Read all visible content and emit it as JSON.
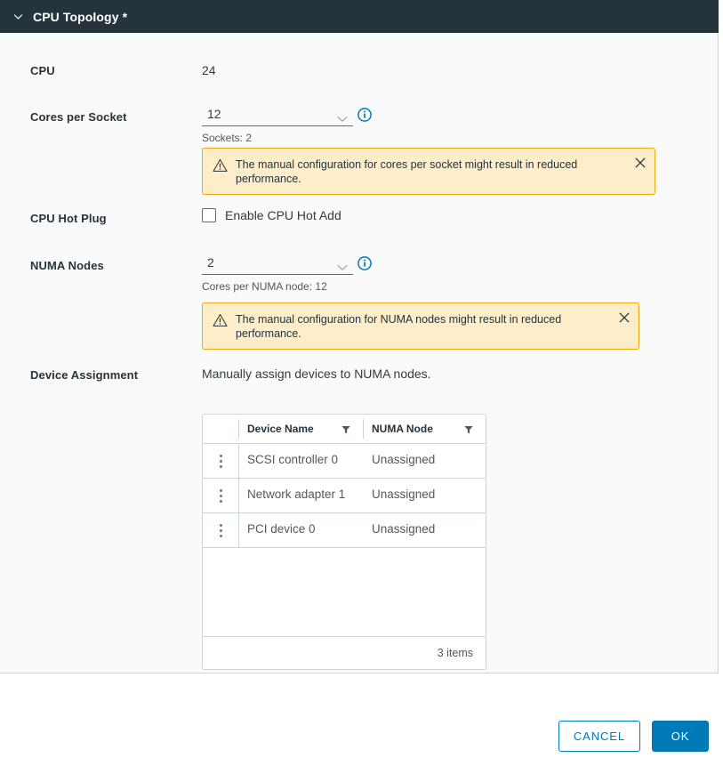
{
  "header": {
    "title": "CPU Topology *",
    "collapse_icon": "chevron-down-icon"
  },
  "fields": {
    "cpu": {
      "label": "CPU",
      "value": "24"
    },
    "cores_per_socket": {
      "label": "Cores per Socket",
      "value": "12",
      "info_icon": "info-circle-icon",
      "note": "Sockets: 2"
    },
    "cpu_hot_plug": {
      "label": "CPU Hot Plug",
      "checkbox_label": "Enable CPU Hot Add",
      "checked": false
    },
    "numa_nodes": {
      "label": "NUMA Nodes",
      "value": "2",
      "info_icon": "info-circle-icon",
      "note": "Cores per NUMA node: 12"
    },
    "device_assignment": {
      "label": "Device Assignment",
      "description": "Manually assign devices to NUMA nodes."
    }
  },
  "alerts": [
    {
      "icon": "warning-triangle-icon",
      "text": "The manual configuration for cores per socket might result in reduced performance.",
      "close_icon": "close-icon"
    },
    {
      "icon": "warning-triangle-icon",
      "text": "The manual configuration for NUMA nodes might result in reduced performance.",
      "close_icon": "close-icon"
    }
  ],
  "grid": {
    "columns": [
      {
        "label": "",
        "filter": false
      },
      {
        "label": "Device Name",
        "filter": true,
        "filter_icon": "filter-icon"
      },
      {
        "label": "NUMA Node",
        "filter": true,
        "filter_icon": "filter-icon"
      }
    ],
    "rows": [
      {
        "menu_icon": "kebab-menu-icon",
        "device_name": "SCSI controller 0",
        "numa_node": "Unassigned"
      },
      {
        "menu_icon": "kebab-menu-icon",
        "device_name": "Network adapter 1",
        "numa_node": "Unassigned"
      },
      {
        "menu_icon": "kebab-menu-icon",
        "device_name": "PCI device 0",
        "numa_node": "Unassigned"
      }
    ],
    "footer": "3 items"
  },
  "footer": {
    "cancel_label": "CANCEL",
    "ok_label": "OK"
  },
  "colors": {
    "header_bg": "#25333d",
    "panel_bg": "#fafafa",
    "accent": "#0079b8",
    "alert_bg": "#fdedc8",
    "alert_border": "#efa80f",
    "border": "#cbd4d8"
  }
}
